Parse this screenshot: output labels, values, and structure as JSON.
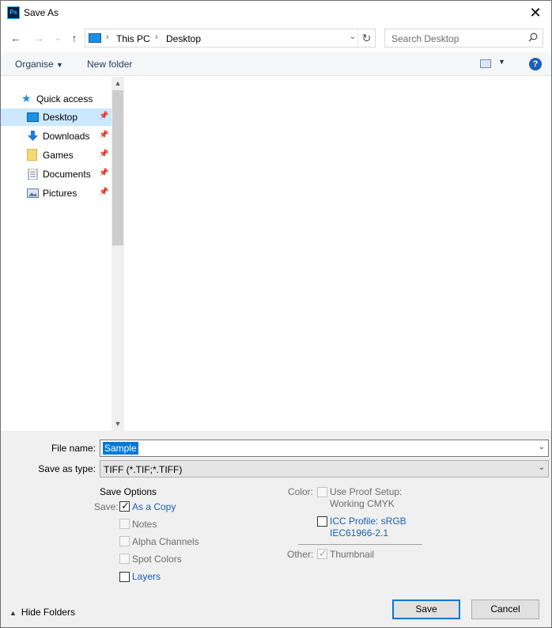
{
  "window": {
    "title": "Save As",
    "app_icon": "Ps",
    "close_glyph": "✕"
  },
  "nav": {
    "back_icon": "←",
    "forward_icon": "→",
    "recent_icon": "⌄",
    "up_icon": "↑",
    "breadcrumb": [
      "This PC",
      "Desktop"
    ],
    "refresh_icon": "↻",
    "search_placeholder": "Search Desktop"
  },
  "toolbar": {
    "organise_label": "Organise",
    "new_folder_label": "New folder",
    "help_label": "?"
  },
  "sidebar": {
    "quick_access": "Quick access",
    "items": [
      {
        "label": "Desktop",
        "icon": "desktop-icon",
        "selected": true
      },
      {
        "label": "Downloads",
        "icon": "download-icon"
      },
      {
        "label": "Games",
        "icon": "folder-icon"
      },
      {
        "label": "Documents",
        "icon": "documents-icon"
      },
      {
        "label": "Pictures",
        "icon": "pictures-icon"
      }
    ]
  },
  "form": {
    "file_name_label": "File name:",
    "file_name_value": "Sample",
    "save_type_label": "Save as type:",
    "save_type_value": "TIFF (*.TIF;*.TIFF)"
  },
  "save_options": {
    "heading": "Save Options",
    "save_label": "Save:",
    "as_a_copy": "As a Copy",
    "notes": "Notes",
    "alpha_channels": "Alpha Channels",
    "spot_colors": "Spot Colors",
    "layers": "Layers",
    "color_label": "Color:",
    "use_proof_line1": "Use Proof Setup:",
    "use_proof_line2": "Working CMYK",
    "icc_line1": "ICC Profile:  sRGB",
    "icc_line2": "IEC61966-2.1",
    "other_label": "Other:",
    "thumbnail": "Thumbnail"
  },
  "footer": {
    "hide_folders": "Hide Folders",
    "save_button": "Save",
    "cancel_button": "Cancel"
  },
  "colors": {
    "accent": "#0078d7",
    "selected_bg": "#cce8ff",
    "link": "#1a5fb4"
  }
}
